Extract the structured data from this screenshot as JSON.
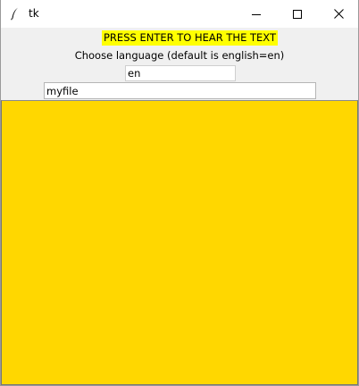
{
  "window": {
    "title": "tk",
    "icons": {
      "app": "feather-icon",
      "minimize": "minimize-icon",
      "maximize": "maximize-icon",
      "close": "close-icon"
    }
  },
  "main": {
    "press_label": "PRESS ENTER TO HEAR THE TEXT",
    "press_label_bg": "#ffff00",
    "language_label": "Choose language (default is english=en)",
    "language_value": "en",
    "filename_value": "myfile",
    "text_value": "",
    "text_bg": "#ffd700"
  }
}
